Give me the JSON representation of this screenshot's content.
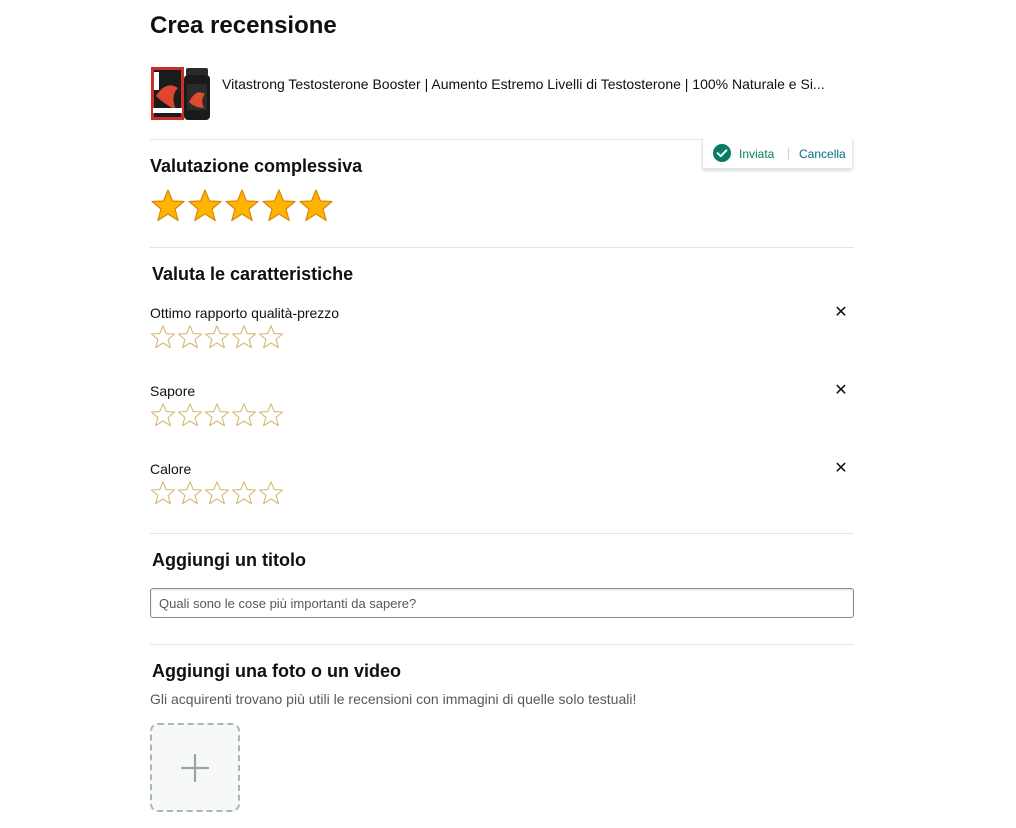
{
  "page_title": "Crea recensione",
  "product": {
    "name": "Vitastrong Testosterone Booster | Aumento Estremo Livelli di Testosterone | 100% Naturale e Si...",
    "image_icon": "product-thumbnail"
  },
  "overall_rating": {
    "heading": "Valutazione complessiva",
    "rating": 5,
    "max": 5
  },
  "saved_popover": {
    "status": "Inviata",
    "separator": "|",
    "cancel_label": "Cancella",
    "status_icon": "check-circle-icon"
  },
  "features": {
    "heading": "Valuta le caratteristiche",
    "clear_symbol": "✕",
    "items": [
      {
        "label": "Ottimo rapporto qualità-prezzo",
        "rating": 0
      },
      {
        "label": "Sapore",
        "rating": 0
      },
      {
        "label": "Calore",
        "rating": 0
      }
    ]
  },
  "title_section": {
    "heading": "Aggiungi un titolo",
    "placeholder": "Quali sono le cose più importanti da sapere?",
    "value": ""
  },
  "media_section": {
    "heading": "Aggiungi una foto o un video",
    "hint": "Gli acquirenti trovano più utili le recensioni con immagini di quelle solo testuali!",
    "upload_icon": "plus-icon"
  },
  "colors": {
    "star_fill": "#ffb400",
    "star_stroke": "#d9860b",
    "star_empty_stroke": "#d5b976",
    "success": "#067d62",
    "link": "#007185"
  }
}
